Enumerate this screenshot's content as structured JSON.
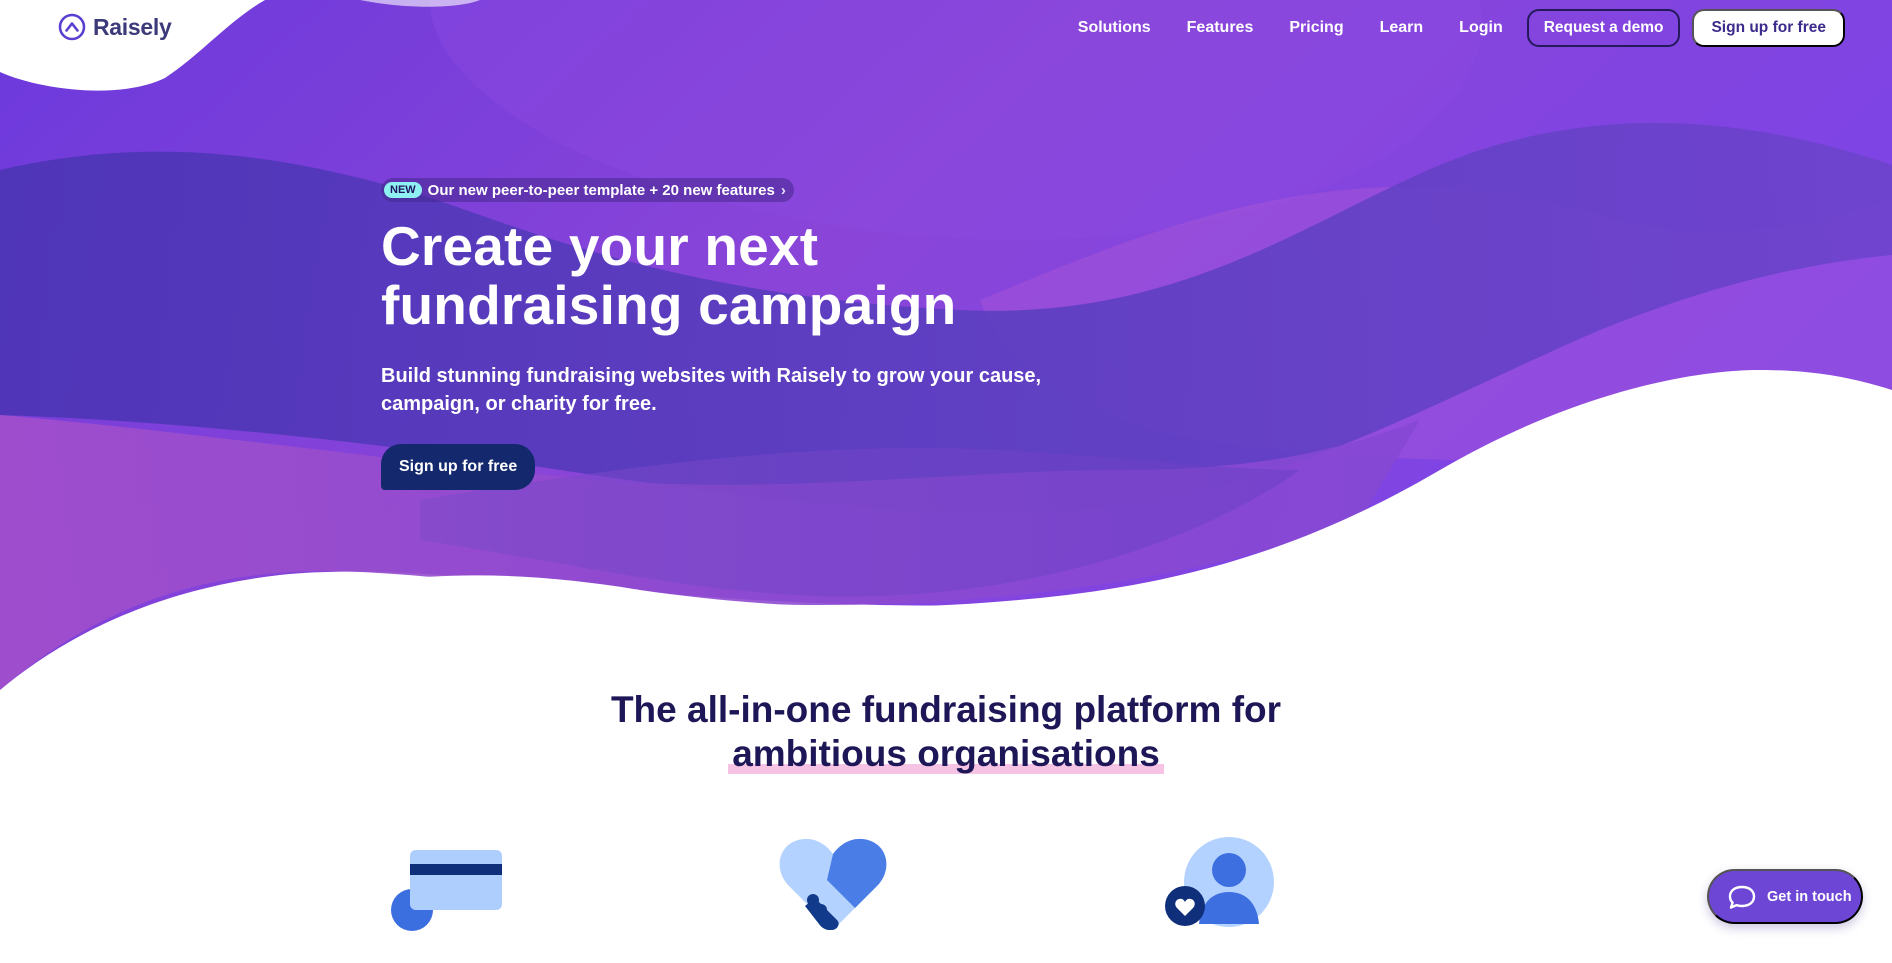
{
  "brand": {
    "name": "Raisely"
  },
  "nav": {
    "links": [
      {
        "label": "Solutions"
      },
      {
        "label": "Features"
      },
      {
        "label": "Pricing"
      },
      {
        "label": "Learn"
      },
      {
        "label": "Login"
      }
    ],
    "demo_button": "Request a demo",
    "signup_button": "Sign up for free"
  },
  "hero": {
    "announcement": {
      "badge": "NEW",
      "text": "Our new peer-to-peer template + 20 new features"
    },
    "title": "Create your next fundraising campaign",
    "subtitle": "Build stunning fundraising websites with Raisely to grow your cause, campaign, or charity for free.",
    "cta": "Sign up for free"
  },
  "platform": {
    "heading_line1": "The all-in-one fundraising platform for",
    "heading_highlight": "ambitious organisations"
  },
  "feature_icons": [
    "credit-card-icon",
    "handshake-heart-icon",
    "person-heart-icon"
  ],
  "chat": {
    "label": "Get in touch"
  },
  "colors": {
    "hero_purple": "#7b3fe0",
    "hero_deep": "#4d32b8",
    "navy_button": "#14286e",
    "heading_text": "#1e1757",
    "highlight_pink": "#f7c3e4",
    "chat_purple": "#6e46d6"
  }
}
